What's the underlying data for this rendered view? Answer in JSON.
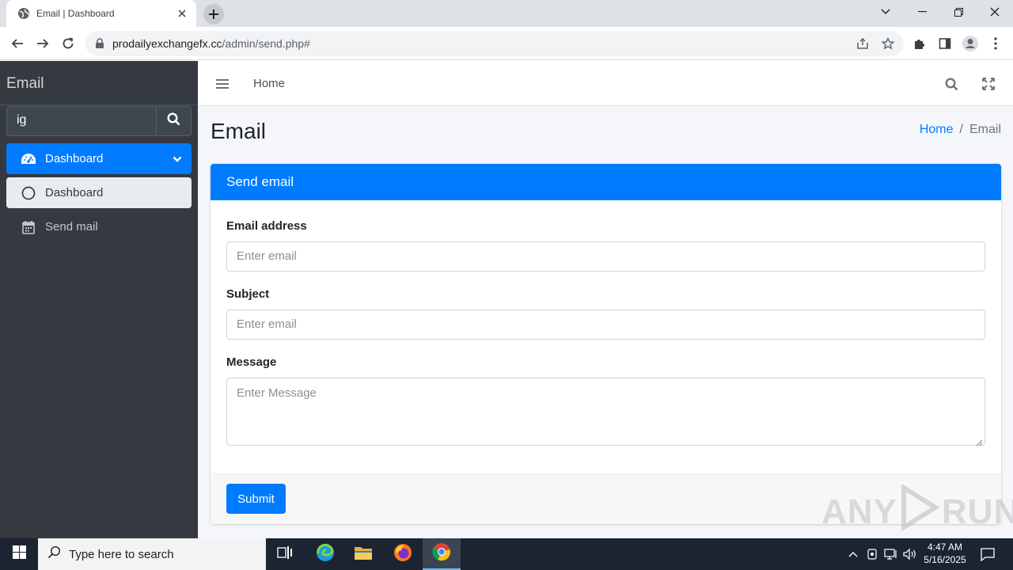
{
  "browser": {
    "tab_title": "Email | Dashboard",
    "url_host": "prodailyexchangefx.cc",
    "url_path": "/admin/send.php#"
  },
  "sidebar": {
    "brand": "Email",
    "search_value": "ig",
    "items": [
      {
        "label": "Dashboard"
      },
      {
        "label": "Dashboard"
      },
      {
        "label": "Send mail"
      }
    ]
  },
  "topnav": {
    "home_label": "Home"
  },
  "page": {
    "title": "Email",
    "breadcrumb": {
      "home": "Home",
      "separator": "/",
      "current": "Email"
    }
  },
  "card": {
    "header": "Send email",
    "fields": [
      {
        "label": "Email address",
        "placeholder": "Enter email"
      },
      {
        "label": "Subject",
        "placeholder": "Enter email"
      },
      {
        "label": "Message",
        "placeholder": "Enter Message"
      }
    ],
    "submit_label": "Submit"
  },
  "watermark": {
    "left": "ANY",
    "right": "RUN"
  },
  "taskbar": {
    "search_placeholder": "Type here to search",
    "time": "4:47 AM",
    "date": "5/16/2025"
  },
  "colors": {
    "primary": "#007bff",
    "sidebar_bg": "#343a40",
    "content_bg": "#f4f6f9",
    "taskbar_bg": "#1c2431"
  }
}
